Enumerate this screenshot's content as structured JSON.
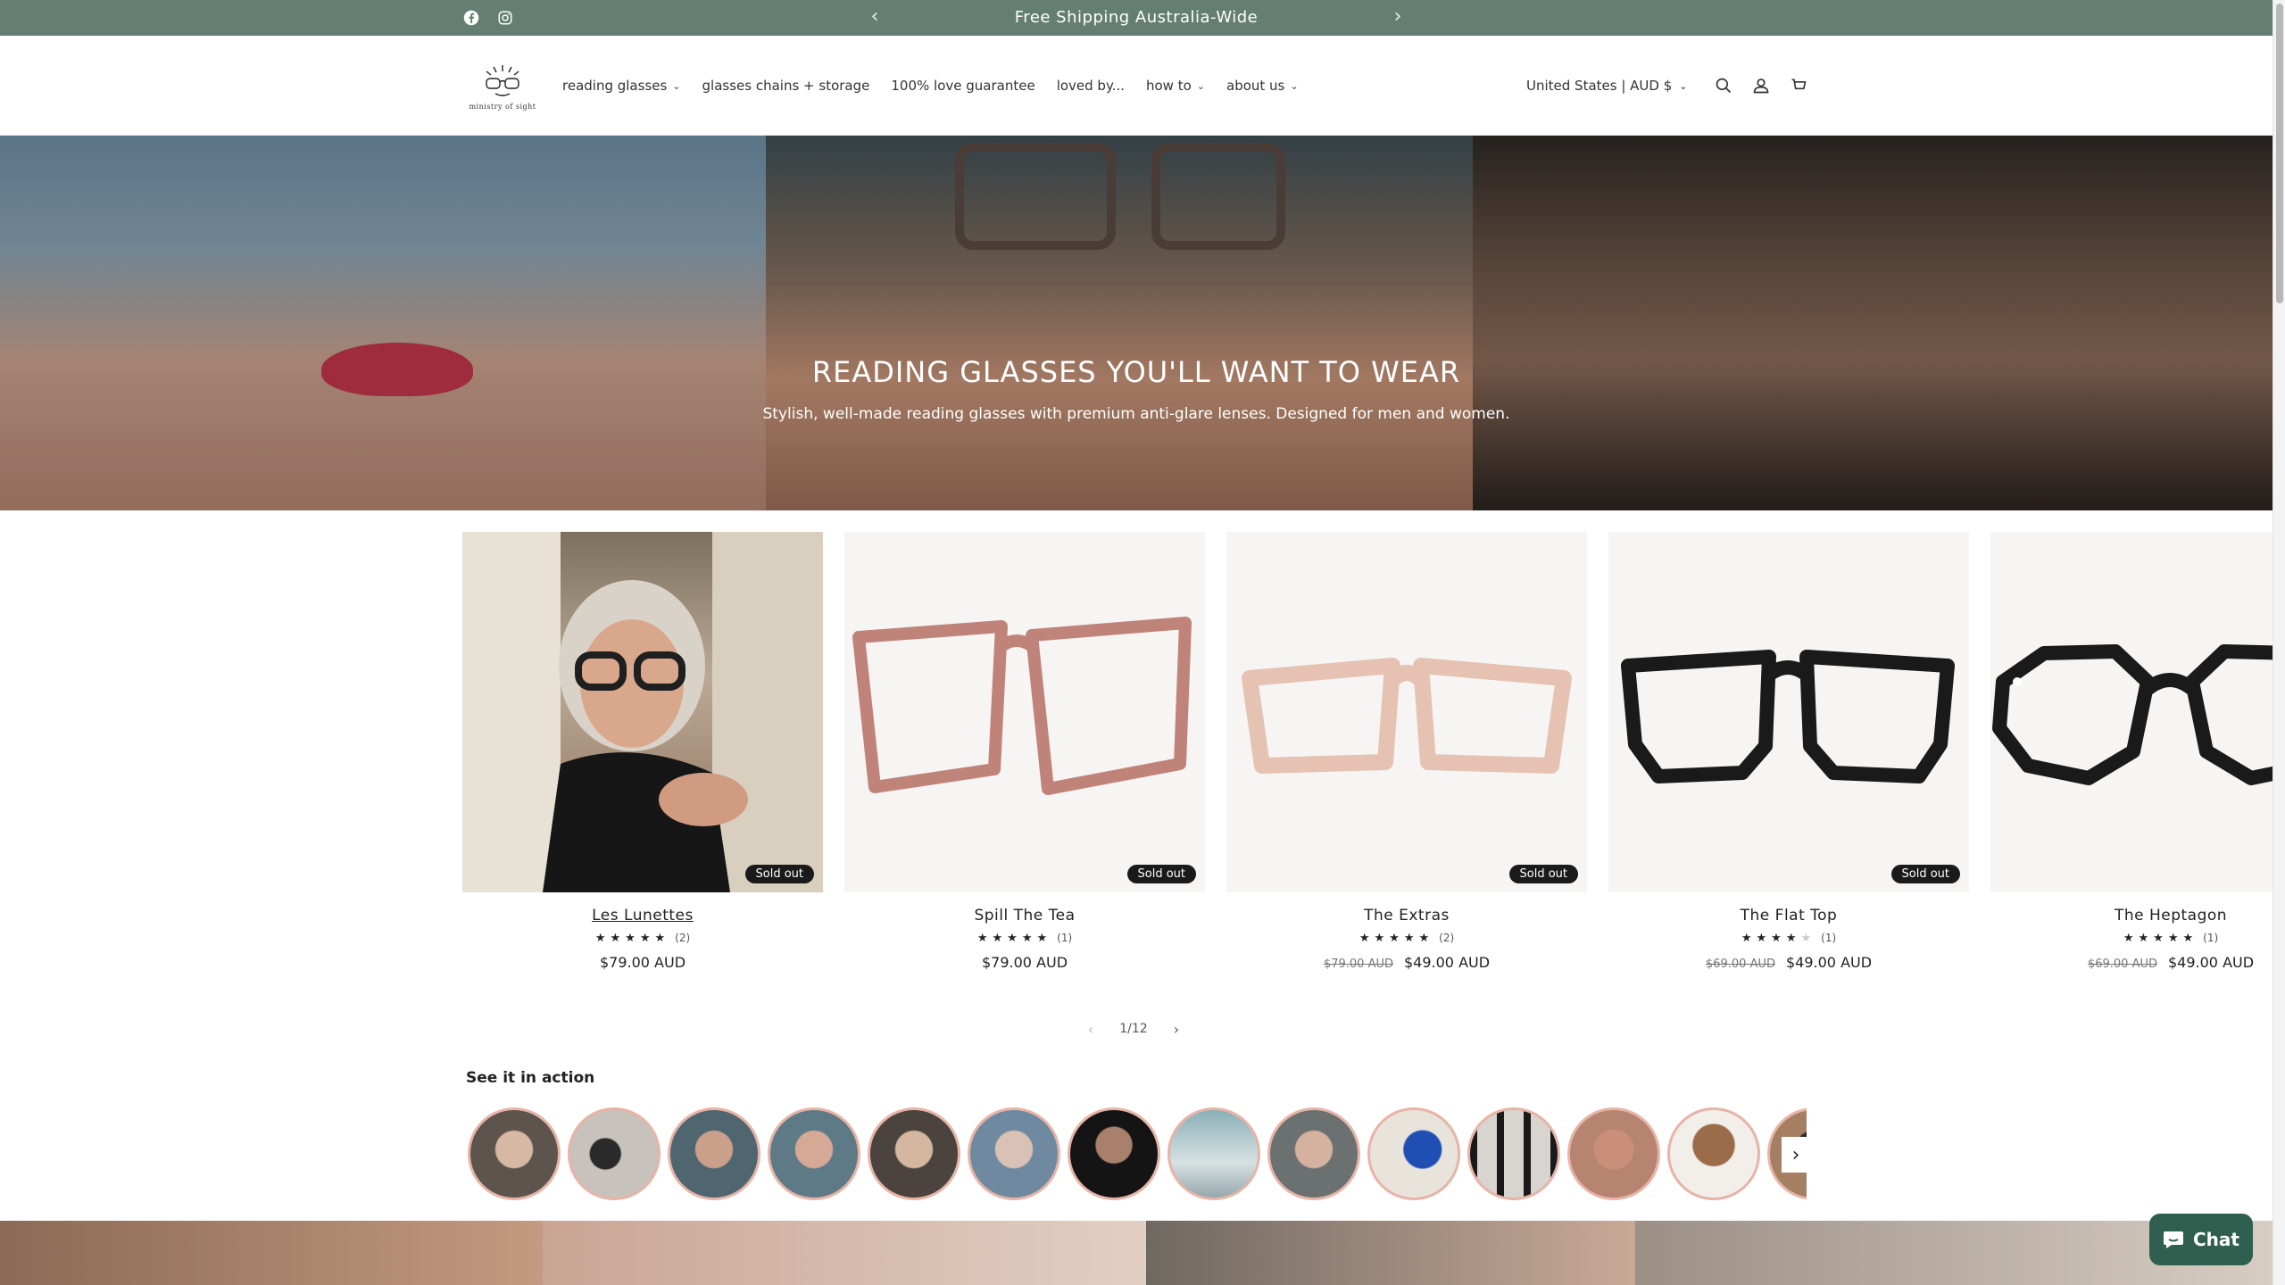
{
  "announcement": {
    "message": "Free Shipping Australia-Wide",
    "prev_icon": "chevron-left-icon",
    "next_icon": "chevron-right-icon",
    "background": "#647f72",
    "social": [
      "facebook-icon",
      "instagram-icon"
    ]
  },
  "header": {
    "logo_text": "ministry of sight",
    "nav": [
      {
        "label": "reading glasses",
        "dropdown": true
      },
      {
        "label": "glasses chains + storage",
        "dropdown": false
      },
      {
        "label": "100% love guarantee",
        "dropdown": false
      },
      {
        "label": "loved by...",
        "dropdown": false
      },
      {
        "label": "how to",
        "dropdown": true
      },
      {
        "label": "about us",
        "dropdown": true
      }
    ],
    "country": "United States | AUD $",
    "tools": [
      "search-icon",
      "account-icon",
      "cart-icon"
    ]
  },
  "hero": {
    "title": "READING GLASSES YOU'LL WANT TO WEAR",
    "subtitle": "Stylish, well-made reading glasses with premium anti-glare lenses. Designed for men and women."
  },
  "products": [
    {
      "title": "Les Lunettes",
      "stars": 5,
      "reviews": "(2)",
      "old_price": "",
      "price": "$79.00 AUD",
      "badge": "Sold out"
    },
    {
      "title": "Spill The Tea",
      "stars": 5,
      "reviews": "(1)",
      "old_price": "",
      "price": "$79.00 AUD",
      "badge": "Sold out"
    },
    {
      "title": "The Extras",
      "stars": 5,
      "reviews": "(2)",
      "old_price": "$79.00 AUD",
      "price": "$49.00 AUD",
      "badge": "Sold out"
    },
    {
      "title": "The Flat Top",
      "stars": 4,
      "reviews": "(1)",
      "old_price": "$69.00 AUD",
      "price": "$49.00 AUD",
      "badge": "Sold out"
    },
    {
      "title": "The Heptagon",
      "stars": 5,
      "reviews": "(1)",
      "old_price": "$69.00 AUD",
      "price": "$49.00 AUD",
      "badge": ""
    }
  ],
  "pager": {
    "label": "1/12"
  },
  "see_it_in_action": {
    "title": "See it in action",
    "ring_color": "#e7b4a7"
  },
  "chat": {
    "label": "Chat",
    "background": "#2f5f4e"
  }
}
